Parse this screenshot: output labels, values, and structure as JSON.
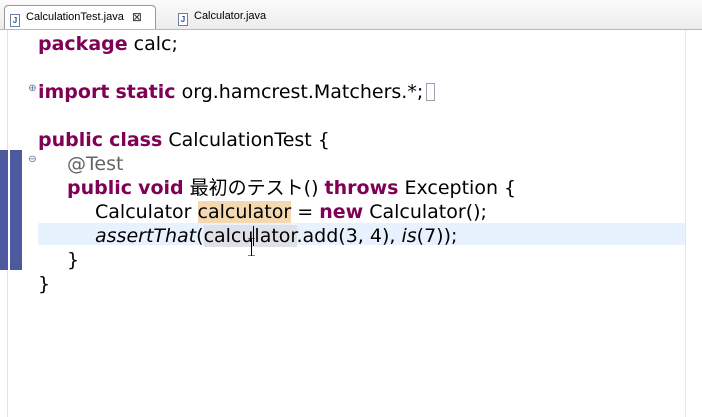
{
  "tabs": [
    {
      "label": "CalculationTest.java",
      "active": true,
      "icon": "java-file-icon",
      "close": "⊠"
    },
    {
      "label": "Calculator.java",
      "active": false,
      "icon": "java-file-icon"
    }
  ],
  "colors": {
    "keyword": "#7f0055",
    "annotation": "#646464",
    "occurrence_highlight": "#f4d8b0",
    "current_line": "#e8f2fe",
    "change_marker": "#4e5aa0"
  },
  "code": {
    "l1": {
      "kw": "package",
      "rest": " calc;"
    },
    "l2": {
      "kw1": "import",
      "kw2": "static",
      "rest": " org.hamcrest.Matchers.*;"
    },
    "l3": {
      "kw1": "public",
      "kw2": "class",
      "rest": " CalculationTest {"
    },
    "l4": {
      "annotation": "@Test"
    },
    "l5": {
      "kw1": "public",
      "kw2": "void",
      "name": " 最初のテスト() ",
      "kw3": "throws",
      "rest": " Exception {"
    },
    "l6": {
      "type": "Calculator ",
      "var": "calculator",
      "eq": " = ",
      "kw": "new",
      "rest": " Calculator();"
    },
    "l7": {
      "method": "assertThat",
      "open": "(",
      "var_a": "calcu",
      "var_b": "lator",
      "mid": ".add(3, 4), ",
      "is": "is",
      "end": "(7));"
    },
    "l8": {
      "text": "}"
    },
    "l9": {
      "text": "}"
    }
  }
}
